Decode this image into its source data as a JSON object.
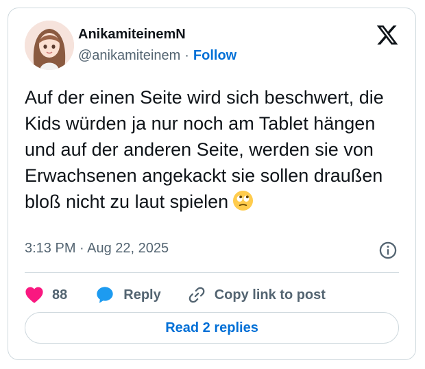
{
  "author": {
    "display_name": "AnikamiteinemN",
    "handle": "@anikamiteinem",
    "separator": "·",
    "follow_label": "Follow",
    "avatar_icon": "avatar-illustration"
  },
  "platform_icon": "x-logo-icon",
  "tweet": {
    "text": "Auf der einen Seite wird sich beschwert, die Kids würden ja nur noch am Tablet hängen und auf der anderen Seite, werden sie von Erwachsenen angekackt sie sollen draußen bloß nicht zu laut spielen",
    "emoji": "face-with-rolling-eyes-emoji",
    "timestamp": "3:13 PM · Aug 22, 2025"
  },
  "actions": {
    "like_count": "88",
    "reply_label": "Reply",
    "copy_label": "Copy link to post"
  },
  "read_replies_label": "Read 2 replies",
  "colors": {
    "accent": "#006fd6",
    "heart": "#f91880",
    "reply_bubble": "#1d9bf0",
    "muted": "#536471",
    "border": "#cfd9de"
  }
}
